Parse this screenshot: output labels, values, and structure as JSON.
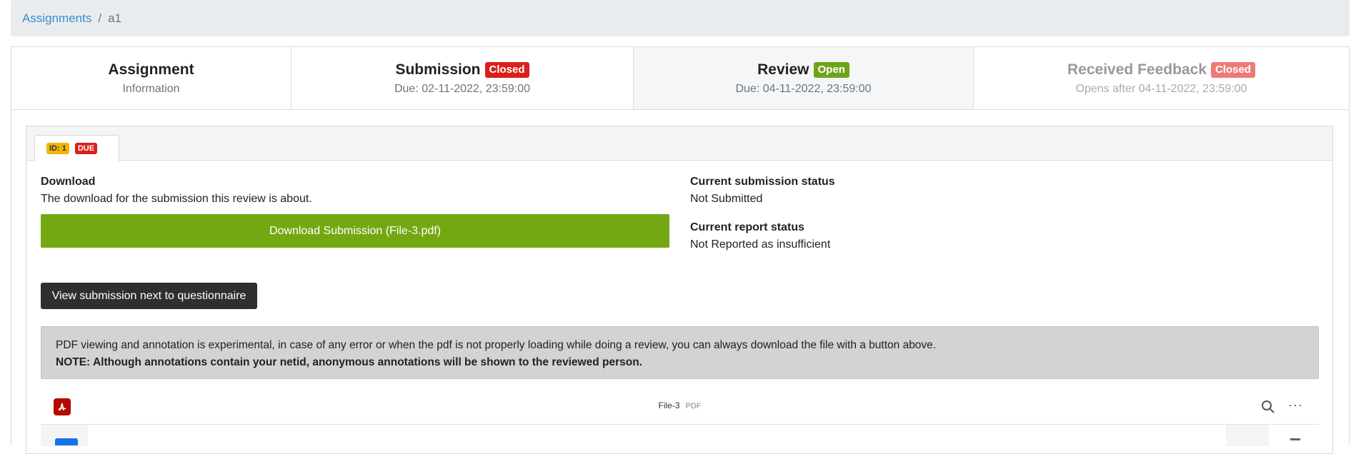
{
  "breadcrumb": {
    "root": "Assignments",
    "separator": "/",
    "current": "a1"
  },
  "steps": [
    {
      "title": "Assignment",
      "badge": "",
      "sub": "Information"
    },
    {
      "title": "Submission",
      "badge": "Closed",
      "sub": "Due: 02-11-2022, 23:59:00"
    },
    {
      "title": "Review",
      "badge": "Open",
      "sub": "Due: 04-11-2022, 23:59:00"
    },
    {
      "title": "Received Feedback",
      "badge": "Closed",
      "sub": "Opens after 04-11-2022, 23:59:00"
    }
  ],
  "tab": {
    "id_label": "ID: 1",
    "due_label": "DUE"
  },
  "download": {
    "label": "Download",
    "description": "The download for the submission this review is about.",
    "button": "Download Submission (File-3.pdf)"
  },
  "submission_status": {
    "label": "Current submission status",
    "value": "Not Submitted"
  },
  "report_status": {
    "label": "Current report status",
    "value": "Not Reported as insufficient"
  },
  "view_button": "View submission next to questionnaire",
  "notice": {
    "line1": "PDF viewing and annotation is experimental, in case of any error or when the pdf is not properly loading while doing a review, you can always download the file with a button above.",
    "line2": "NOTE: Although annotations contain your netid, anonymous annotations will be shown to the reviewed person."
  },
  "pdf_viewer": {
    "file_name": "File-3",
    "file_ext": "PDF",
    "more": "···"
  },
  "colors": {
    "accent": "#3490c9",
    "closed": "#d9201c",
    "open": "#6fa31a",
    "download": "#73a812",
    "pdf": "#b30b00"
  }
}
